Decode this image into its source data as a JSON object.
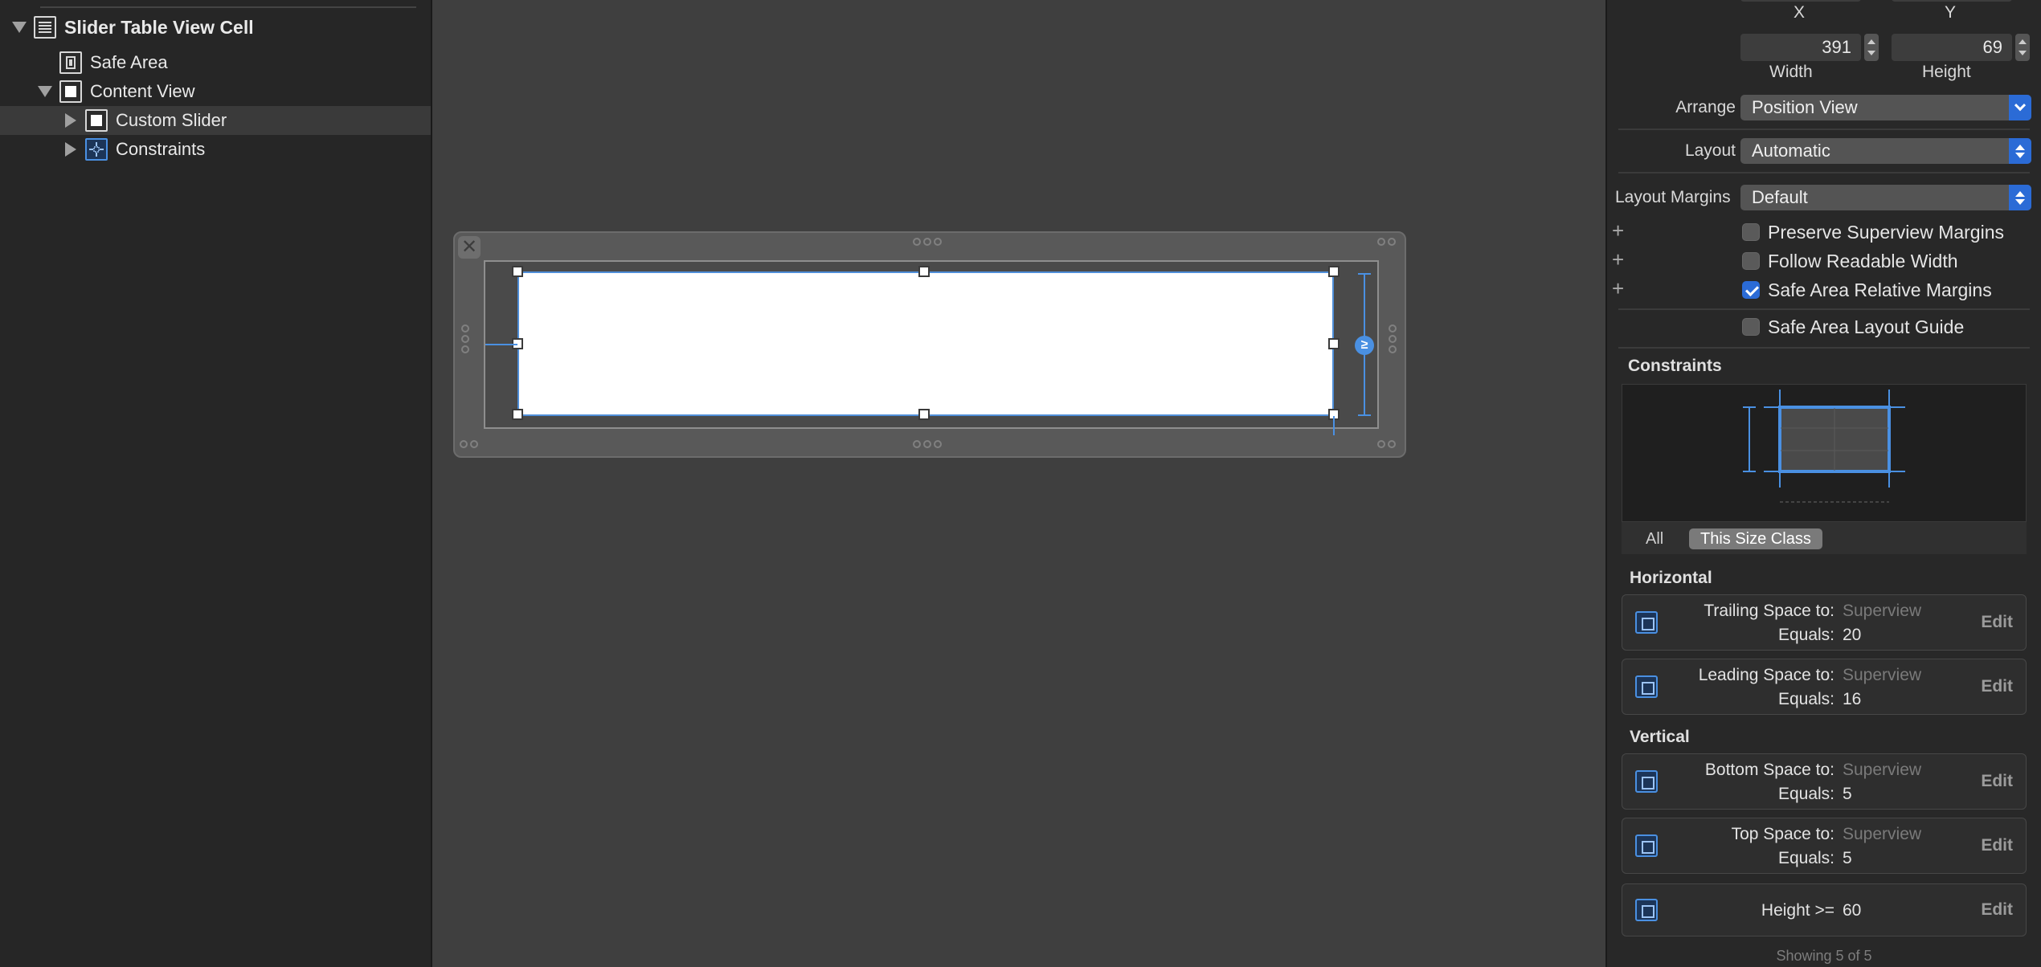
{
  "outline": {
    "items": [
      {
        "label": "Slider Table View Cell",
        "icon": "table-cell-icon"
      },
      {
        "label": "Safe Area",
        "icon": "safe-area-icon"
      },
      {
        "label": "Content View",
        "icon": "view-icon"
      },
      {
        "label": "Custom Slider",
        "icon": "view-icon"
      },
      {
        "label": "Constraints",
        "icon": "constraints-icon"
      }
    ]
  },
  "inspector": {
    "x_label": "X",
    "y_label": "Y",
    "width": {
      "value": "391",
      "label": "Width"
    },
    "height": {
      "value": "69",
      "label": "Height"
    },
    "arrange": {
      "label": "Arrange",
      "value": "Position View"
    },
    "layout": {
      "label": "Layout",
      "value": "Automatic"
    },
    "layout_margins": {
      "label": "Layout Margins",
      "value": "Default"
    },
    "checkboxes": [
      {
        "label": "Preserve Superview Margins",
        "checked": false
      },
      {
        "label": "Follow Readable Width",
        "checked": false
      },
      {
        "label": "Safe Area Relative Margins",
        "checked": true
      },
      {
        "label": "Safe Area Layout Guide",
        "checked": false
      }
    ],
    "constraints_title": "Constraints",
    "size_class_tabs": {
      "all": "All",
      "this": "This Size Class"
    },
    "horizontal_title": "Horizontal",
    "vertical_title": "Vertical",
    "horizontal": [
      {
        "key": "Trailing Space to:",
        "target": "Superview",
        "equals_label": "Equals:",
        "value": "20",
        "edit": "Edit"
      },
      {
        "key": "Leading Space to:",
        "target": "Superview",
        "equals_label": "Equals:",
        "value": "16",
        "edit": "Edit"
      }
    ],
    "vertical": [
      {
        "key": "Bottom Space to:",
        "target": "Superview",
        "equals_label": "Equals:",
        "value": "5",
        "edit": "Edit"
      },
      {
        "key": "Top Space to:",
        "target": "Superview",
        "equals_label": "Equals:",
        "value": "5",
        "edit": "Edit"
      }
    ],
    "height_constraint": {
      "key": "Height >=",
      "value": "60",
      "edit": "Edit"
    },
    "showing": "Showing 5 of 5"
  },
  "colors": {
    "accent": "#2b6bd6",
    "constraint_blue": "#4a90e2",
    "canvas": "#3f3f3f",
    "panel": "#282828"
  }
}
